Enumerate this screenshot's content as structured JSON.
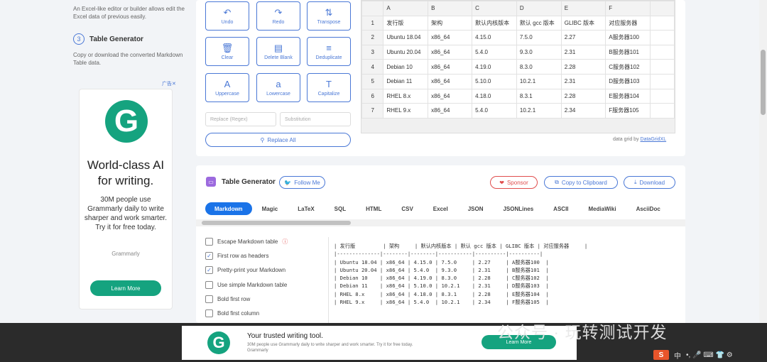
{
  "sidebar": {
    "intro": "An Excel-like editor or builder allows edit the Excel data of previous easily.",
    "step_number": "3",
    "step_title": "Table Generator",
    "step_desc": "Copy or download the converted Markdown Table data."
  },
  "sidebar_ad": {
    "label": "广告✕",
    "logo_letter": "G",
    "headline": "World-class AI for writing.",
    "sub": "30M people use Grammarly daily to write sharper and work smarter. Try it for free today.",
    "brand": "Grammarly",
    "button": "Learn More"
  },
  "tools": {
    "undo": {
      "label": "Undo",
      "icon": "↶"
    },
    "redo": {
      "label": "Redo",
      "icon": "↷"
    },
    "transpose": {
      "label": "Transpose",
      "icon": "⇅"
    },
    "clear": {
      "label": "Clear",
      "icon": "🗑"
    },
    "delete_blank": {
      "label": "Delete Blank",
      "icon": "▤"
    },
    "deduplicate": {
      "label": "Deduplicate",
      "icon": "≡"
    },
    "uppercase": {
      "label": "Uppercase",
      "icon": "A"
    },
    "lowercase": {
      "label": "Lowercase",
      "icon": "a"
    },
    "capitalize": {
      "label": "Capitalize",
      "icon": "T"
    },
    "replace_placeholder": "Replace (Regex)",
    "substitution_placeholder": "Substitution",
    "replace_all": "Replace All"
  },
  "grid": {
    "col_letters": [
      "A",
      "B",
      "C",
      "D",
      "E",
      "F"
    ],
    "rows": [
      {
        "n": "1",
        "cells": [
          "发行版",
          "架构",
          "默认内核版本",
          "默认 gcc 版本",
          "GLIBC 版本",
          "对应服务器"
        ]
      },
      {
        "n": "2",
        "cells": [
          "Ubuntu 18.04",
          "x86_64",
          "4.15.0",
          "7.5.0",
          "2.27",
          "A服务器100"
        ]
      },
      {
        "n": "3",
        "cells": [
          "Ubuntu 20.04",
          "x86_64",
          "5.4.0",
          "9.3.0",
          "2.31",
          "B服务器101"
        ]
      },
      {
        "n": "4",
        "cells": [
          "Debian 10",
          "x86_64",
          "4.19.0",
          "8.3.0",
          "2.28",
          "C服务器102"
        ]
      },
      {
        "n": "5",
        "cells": [
          "Debian 11",
          "x86_64",
          "5.10.0",
          "10.2.1",
          "2.31",
          "D服务器103"
        ]
      },
      {
        "n": "6",
        "cells": [
          "RHEL 8.x",
          "x86_64",
          "4.18.0",
          "8.3.1",
          "2.28",
          "E服务器104"
        ]
      },
      {
        "n": "7",
        "cells": [
          "RHEL 9.x",
          "x86_64",
          "5.4.0",
          "10.2.1",
          "2.34",
          "F服务器105"
        ]
      }
    ],
    "credit_prefix": "data grid by ",
    "credit_link": "DataGridXL"
  },
  "generator": {
    "title": "Table Generator",
    "follow": "Follow Me",
    "sponsor": "Sponsor",
    "copy": "Copy to Clipboard",
    "download": "Download",
    "tabs": [
      "Markdown",
      "Magic",
      "LaTeX",
      "SQL",
      "HTML",
      "CSV",
      "Excel",
      "JSON",
      "JSONLines",
      "ASCII",
      "MediaWiki",
      "AsciiDoc"
    ],
    "active_tab": 0,
    "options": [
      {
        "label": "Escape Markdown table",
        "checked": false,
        "info": true
      },
      {
        "label": "First row as headers",
        "checked": true
      },
      {
        "label": "Pretty-print your Markdown",
        "checked": true
      },
      {
        "label": "Use simple Markdown table",
        "checked": false
      },
      {
        "label": "Bold first row",
        "checked": false
      },
      {
        "label": "Bold first column",
        "checked": false
      }
    ],
    "output": "| 发行版         | 架构     | 默认内核版本 | 默认 gcc 版本 | GLIBC 版本 | 对应服务器     |\n|--------------|--------|--------|-----------|----------|----------|\n| Ubuntu 18.04 | x86_64 | 4.15.0 | 7.5.0     | 2.27     | A服务器100  |\n| Ubuntu 20.04 | x86_64 | 5.4.0  | 9.3.0     | 2.31     | B服务器101  |\n| Debian 10    | x86_64 | 4.19.0 | 8.3.0     | 2.28     | C服务器102  |\n| Debian 11    | x86_64 | 5.10.0 | 10.2.1    | 2.31     | D服务器103  |\n| RHEL 8.x     | x86_64 | 4.18.0 | 8.3.1     | 2.28     | E服务器104  |\n| RHEL 9.x     | x86_64 | 5.4.0  | 10.2.1    | 2.34     | F服务器105  |"
  },
  "banner": {
    "logo_letter": "G",
    "title": "Your trusted writing tool.",
    "sub": "30M people use Grammarly daily to write sharper and work smarter. Try it for free today.",
    "brand": "Grammarly",
    "button": "Learn More"
  },
  "watermark": "公众号 · 玩转测试开发",
  "tray": {
    "ime": "S",
    "lang": "中",
    "icons": "•, 🎤 ⌨ 👕 ⚙"
  },
  "colors": {
    "accent": "#1a73e8",
    "outline": "#4a78d6",
    "grammarly": "#15a37f",
    "sponsor": "#e04d4d"
  }
}
